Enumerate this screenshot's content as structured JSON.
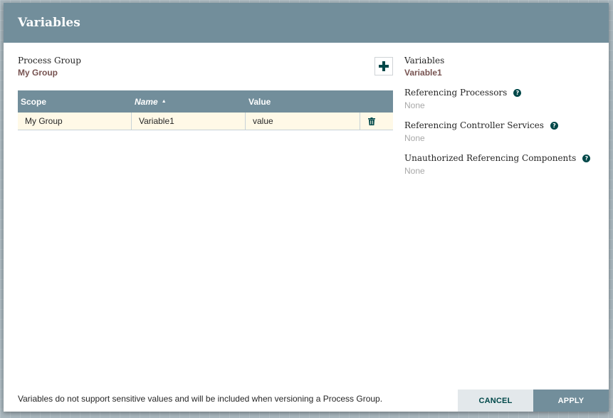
{
  "dialog": {
    "title": "Variables"
  },
  "process_group": {
    "label": "Process Group",
    "value": "My Group"
  },
  "add_button": {
    "icon": "plus-icon"
  },
  "table": {
    "columns": [
      {
        "label": "Scope"
      },
      {
        "label": "Name",
        "sort": "ascending"
      },
      {
        "label": "Value"
      },
      {
        "label": ""
      }
    ],
    "rows": [
      {
        "scope": "My Group",
        "name": "Variable1",
        "value": "value",
        "action_icon": "trash-icon"
      }
    ]
  },
  "details": {
    "variables_label": "Variables",
    "variables_value": "Variable1",
    "sections": [
      {
        "title": "Referencing Processors",
        "value": "None",
        "help_icon": "question-circle-icon"
      },
      {
        "title": "Referencing Controller Services",
        "value": "None",
        "help_icon": "question-circle-icon"
      },
      {
        "title": "Unauthorized Referencing Components",
        "value": "None",
        "help_icon": "question-circle-icon"
      }
    ]
  },
  "footer": {
    "note": "Variables do not support sensitive values and will be included when versioning a Process Group.",
    "cancel_label": "CANCEL",
    "apply_label": "APPLY"
  }
}
